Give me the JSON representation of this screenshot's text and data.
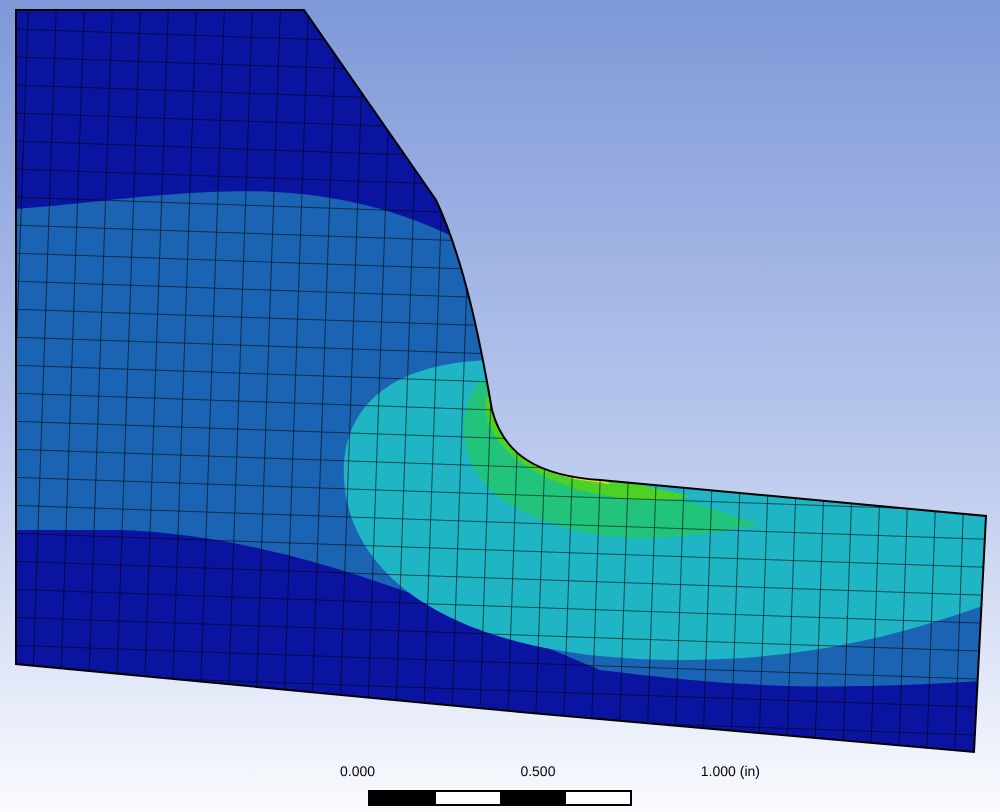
{
  "scale_bar": {
    "labels": [
      "0.000",
      "0.500",
      "1.000 (in)"
    ]
  }
}
